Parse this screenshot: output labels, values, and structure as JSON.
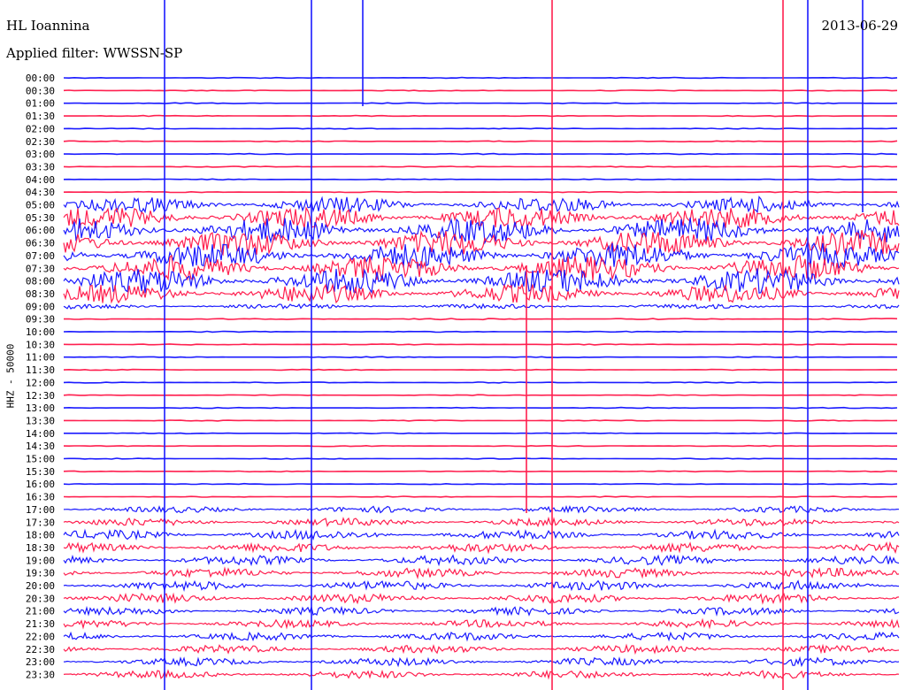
{
  "header": {
    "station": "HL Ioannina",
    "date": "2013-06-29",
    "filter": "Applied filter: WWSSN-SP"
  },
  "channel_label": "HHZ - 50000",
  "colors": {
    "blue": "#1a1aff",
    "red": "#ff1f4f",
    "text": "#000000"
  },
  "chart_data": {
    "type": "line",
    "title": "HL Ioannina",
    "subtitle": "Applied filter: WWSSN-SP",
    "ylabel": "HHZ - 50000",
    "xlabel": "",
    "rows": [
      "00:00",
      "00:30",
      "01:00",
      "01:30",
      "02:00",
      "02:30",
      "03:00",
      "03:30",
      "04:00",
      "04:30",
      "05:00",
      "05:30",
      "06:00",
      "06:30",
      "07:00",
      "07:30",
      "08:00",
      "08:30",
      "09:00",
      "09:30",
      "10:00",
      "10:30",
      "11:00",
      "11:30",
      "12:00",
      "12:30",
      "13:00",
      "13:30",
      "14:00",
      "14:30",
      "15:00",
      "15:30",
      "16:00",
      "16:30",
      "17:00",
      "17:30",
      "18:00",
      "18:30",
      "19:00",
      "19:30",
      "20:00",
      "20:30",
      "21:00",
      "21:30",
      "22:00",
      "22:30",
      "23:00",
      "23:30"
    ],
    "series": [
      {
        "color": "blue",
        "rows": "even"
      },
      {
        "color": "red",
        "rows": "odd"
      }
    ],
    "row_noise_level": [
      0.3,
      0.3,
      0.3,
      0.3,
      0.3,
      0.3,
      0.3,
      0.3,
      0.3,
      0.3,
      5,
      7,
      8,
      8,
      8,
      8,
      8,
      6,
      1.5,
      0.4,
      0.3,
      0.3,
      0.3,
      0.3,
      0.3,
      0.3,
      0.3,
      0.3,
      0.3,
      0.3,
      0.3,
      0.3,
      0.3,
      0.3,
      2,
      2.5,
      3,
      3,
      3,
      3,
      3,
      3,
      2.5,
      2.5,
      2.5,
      2.5,
      2.5,
      2.5
    ],
    "grid": false,
    "legend": "none"
  }
}
